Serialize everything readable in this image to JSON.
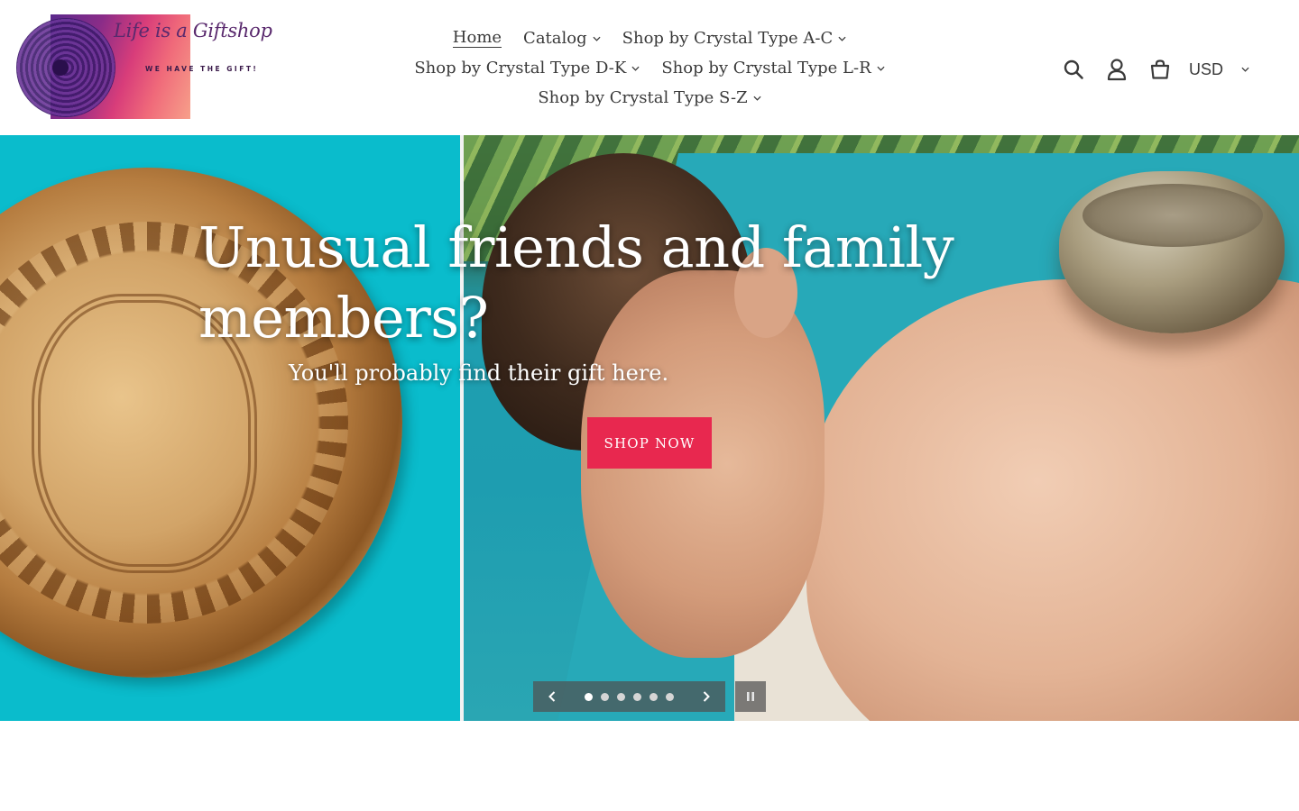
{
  "logo": {
    "title": "Life is a Giftshop",
    "tagline": "WE HAVE THE GIFT!"
  },
  "nav": {
    "rows": [
      [
        {
          "label": "Home",
          "active": true,
          "dropdown": false
        },
        {
          "label": "Catalog",
          "dropdown": true
        },
        {
          "label": "Shop by Crystal Type A-C",
          "dropdown": true
        }
      ],
      [
        {
          "label": "Shop by Crystal Type D-K",
          "dropdown": true
        },
        {
          "label": "Shop by Crystal Type L-R",
          "dropdown": true
        }
      ],
      [
        {
          "label": "Shop by Crystal Type S-Z",
          "dropdown": true
        }
      ]
    ]
  },
  "header": {
    "icons": [
      "search-icon",
      "account-icon",
      "cart-icon"
    ],
    "currency": "USD"
  },
  "hero": {
    "title": "Unusual friends and family members?",
    "subtitle": "You'll probably find their gift here.",
    "button_label": "SHOP NOW",
    "button_color": "#e8284f",
    "slide_count": 6,
    "active_slide": 1
  },
  "colors": {
    "accent": "#e8284f",
    "teal": "#0abccc",
    "text": "#3a3a3a"
  }
}
